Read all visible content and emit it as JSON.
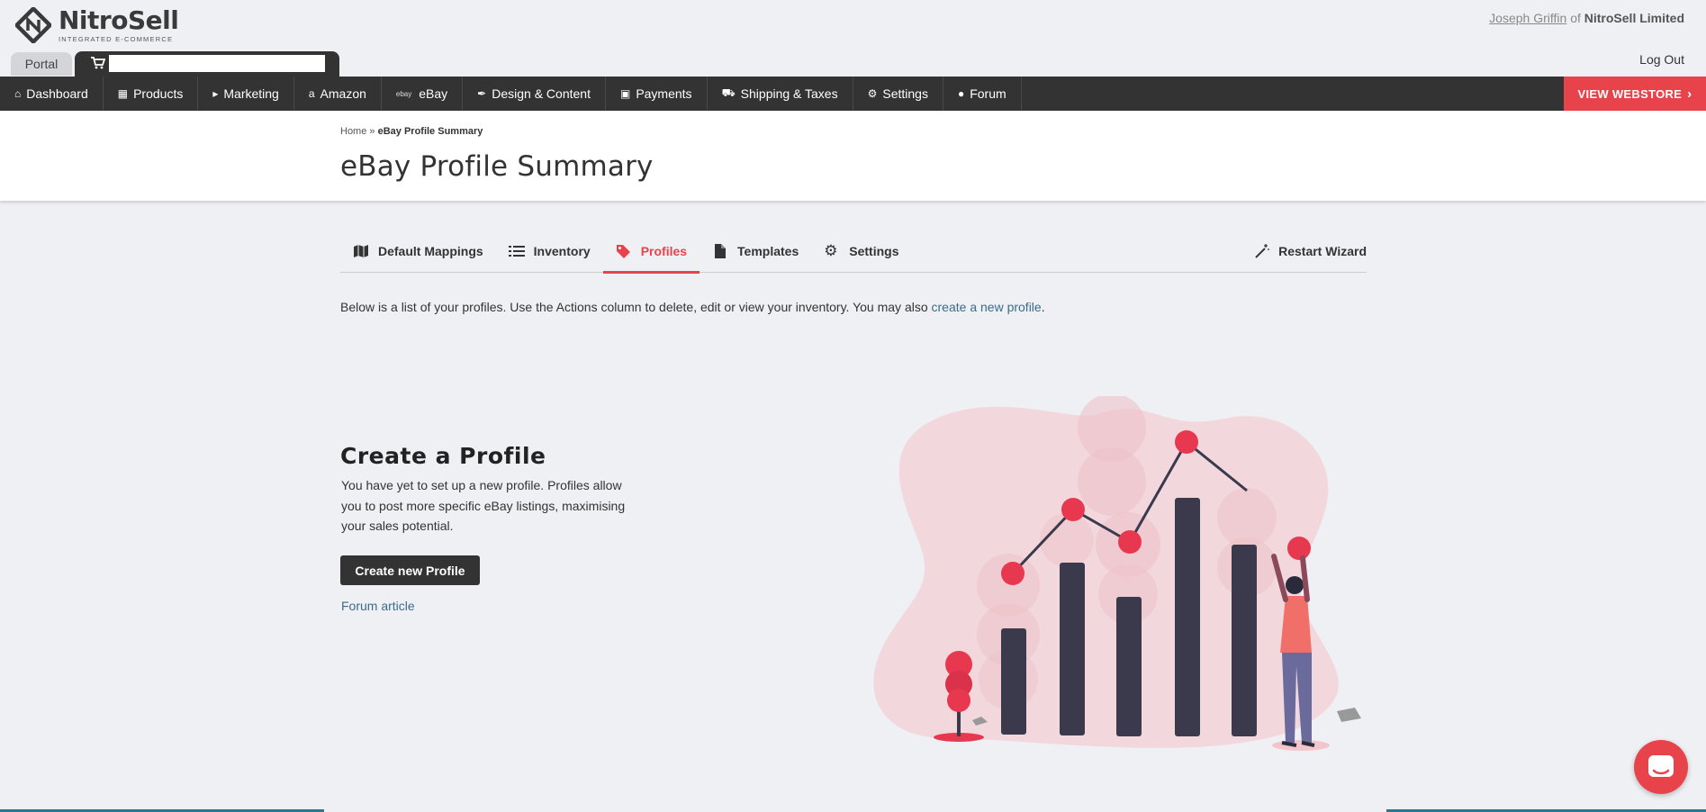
{
  "brand": {
    "name": "NitroSell",
    "tagline": "INTEGRATED E-COMMERCE"
  },
  "user": {
    "name": "Joseph Griffin",
    "of": "of",
    "company": "NitroSell Limited",
    "logout": "Log Out"
  },
  "tabs_top": {
    "portal": "Portal",
    "search_placeholder": ""
  },
  "nav": {
    "items": [
      {
        "label": "Dashboard",
        "icon": "home-icon"
      },
      {
        "label": "Products",
        "icon": "cubes-icon"
      },
      {
        "label": "Marketing",
        "icon": "bullhorn-icon"
      },
      {
        "label": "Amazon",
        "icon": "amazon-icon"
      },
      {
        "label": "eBay",
        "icon": "ebay-icon",
        "prefix": "ebay"
      },
      {
        "label": "Design & Content",
        "icon": "brush-icon"
      },
      {
        "label": "Payments",
        "icon": "money-icon"
      },
      {
        "label": "Shipping & Taxes",
        "icon": "truck-icon"
      },
      {
        "label": "Settings",
        "icon": "gear-icon"
      },
      {
        "label": "Forum",
        "icon": "comment-icon"
      }
    ],
    "view_webstore": "VIEW WEBSTORE"
  },
  "breadcrumb": {
    "home": "Home",
    "sep": "»",
    "current": "eBay Profile Summary"
  },
  "page_title": "eBay Profile Summary",
  "sub_tabs": {
    "items": [
      {
        "label": "Default Mappings",
        "icon": "map-icon",
        "active": false
      },
      {
        "label": "Inventory",
        "icon": "list-icon",
        "active": false
      },
      {
        "label": "Profiles",
        "icon": "tags-icon",
        "active": true
      },
      {
        "label": "Templates",
        "icon": "file-icon",
        "active": false
      },
      {
        "label": "Settings",
        "icon": "gear-icon",
        "active": false
      }
    ],
    "restart": "Restart Wizard"
  },
  "intro": {
    "text": "Below is a list of your profiles. Use the Actions column to delete, edit or view your inventory. You may also ",
    "link": "create a new profile",
    "end": "."
  },
  "empty_state": {
    "title": "Create a Profile",
    "description": "You have yet to set up a new profile. Profiles allow you to post more specific eBay listings, maximising your sales potential.",
    "button": "Create new Profile",
    "forum_link": "Forum article"
  },
  "colors": {
    "accent": "#e8434a",
    "dark": "#333333",
    "link": "#3b6c8a",
    "background": "#eff0f4"
  }
}
